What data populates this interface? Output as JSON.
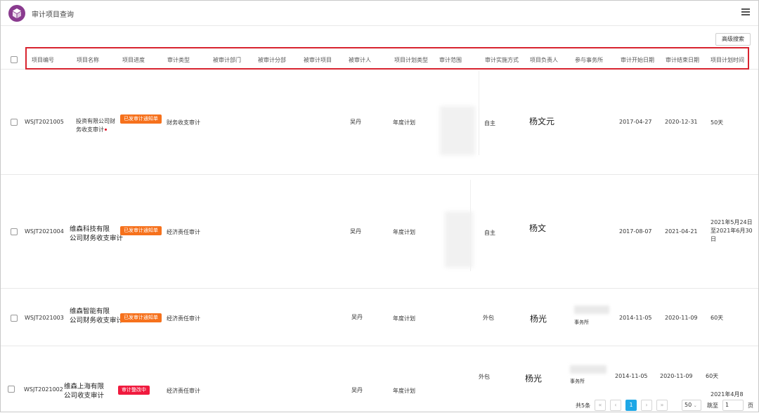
{
  "app": {
    "title": "审计项目查询"
  },
  "toolbar": {
    "advanced_search": "高级搜索"
  },
  "table": {
    "headers": [
      "项目编号",
      "项目名称",
      "项目进度",
      "审计类型",
      "被审计部门",
      "被审计分部",
      "被审计项目",
      "被审计人",
      "项目计划类型",
      "审计范围",
      "审计实施方式",
      "项目负责人",
      "参与事务所",
      "审计开始日期",
      "审计结束日期",
      "项目计划时间"
    ],
    "rows": [
      {
        "id": "WSJT2021005",
        "name_l1": "投资有限公司财",
        "name_l2": "务收支审计",
        "status": "已发审计通知单",
        "audit_type": "财务收支审计",
        "auditee": "吴丹",
        "plan_type": "年度计划",
        "method": "自主",
        "leader": "杨文元",
        "firm": "",
        "start": "2017-04-27",
        "end": "2020-12-31",
        "plan_time": "50天"
      },
      {
        "id": "WSJT2021004",
        "name_l1": "维森科技有限",
        "name_l2": "公司财务收支审计",
        "status": "已发审计通知单",
        "audit_type": "经济责任审计",
        "auditee": "吴丹",
        "plan_type": "年度计划",
        "method": "自主",
        "leader": "杨文",
        "firm": "",
        "start": "2017-08-07",
        "end": "2021-04-21",
        "plan_time_l1": "2021年5月24日",
        "plan_time_l2": "至2021年6月30",
        "plan_time_l3": "日"
      },
      {
        "id": "WSJT2021003",
        "name_l1": "维森智能有限",
        "name_l2": "公司财务收支审计",
        "status": "已发审计通知单",
        "audit_type": "经济责任审计",
        "auditee": "吴丹",
        "plan_type": "年度计划",
        "method": "外包",
        "leader": "杨光",
        "firm": "事务所",
        "start": "2014-11-05",
        "end": "2020-11-09",
        "plan_time": "60天"
      },
      {
        "id": "WSJT2021002",
        "name_l1": "维森上海有限",
        "name_l2": "公司收支审计",
        "status": "审计整改中",
        "audit_type": "经济责任审计",
        "auditee": "吴丹",
        "plan_type": "年度计划",
        "method": "外包",
        "leader": "杨光",
        "firm": "事务所",
        "start": "2014-11-05",
        "end": "2020-11-09",
        "plan_time": "60天",
        "plan_time_extra": "2021年4月8"
      }
    ]
  },
  "pagination": {
    "total": "共5条",
    "current": "1",
    "page_size": "50",
    "jump_label": "跳至",
    "jump_value": "1",
    "page_unit": "页"
  },
  "colors": {
    "accent": "#1ea7e6",
    "badge_orange": "#f6711c",
    "badge_red": "#f01a3e",
    "highlight_border": "#d8242f",
    "logo": "#8a3b8f"
  },
  "icons": [
    "logo-cube-icon",
    "list-menu-icon",
    "chevron-down-icon"
  ]
}
